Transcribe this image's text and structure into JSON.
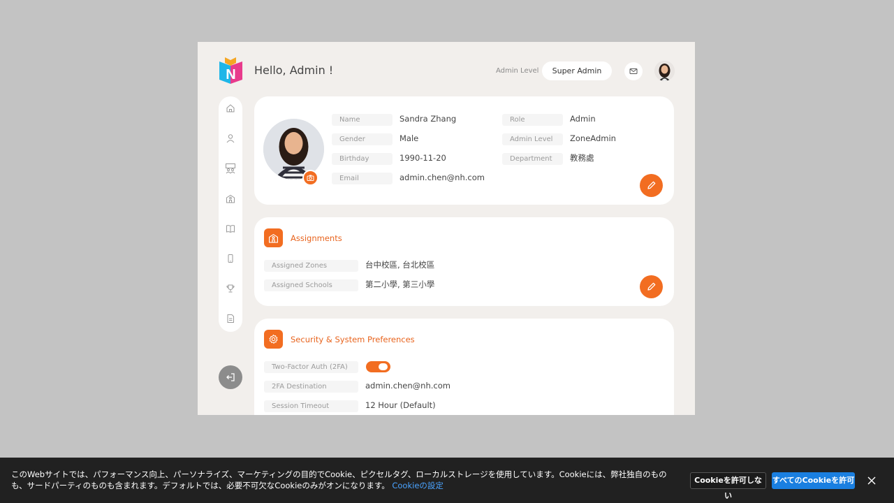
{
  "header": {
    "greeting": "Hello, Admin !",
    "admin_level_label": "Admin Level",
    "admin_level_value": "Super Admin",
    "mail_icon": "mail-icon",
    "avatar": "user-avatar"
  },
  "sidebar": {
    "items": [
      {
        "icon": "home-icon"
      },
      {
        "icon": "user-icon"
      },
      {
        "icon": "classroom-icon"
      },
      {
        "icon": "school-icon"
      },
      {
        "icon": "book-icon"
      },
      {
        "icon": "mobile-icon"
      },
      {
        "icon": "trophy-icon"
      },
      {
        "icon": "document-icon"
      }
    ],
    "logout_icon": "logout-icon"
  },
  "profile": {
    "fields": {
      "name_label": "Name",
      "name_value": "Sandra Zhang",
      "gender_label": "Gender",
      "gender_value": "Male",
      "birthday_label": "Birthday",
      "birthday_value": "1990-11-20",
      "email_label": "Email",
      "email_value": "admin.chen@nh.com",
      "role_label": "Role",
      "role_value": "Admin",
      "admin_level_label": "Admin Level",
      "admin_level_value": "ZoneAdmin",
      "department_label": "Department",
      "department_value": "教務處"
    }
  },
  "assignments": {
    "title": "Assignments",
    "zones_label": "Assigned Zones",
    "zones_value": "台中校區, 台北校區",
    "schools_label": "Assigned Schools",
    "schools_value": "第二小學, 第三小學"
  },
  "security": {
    "title": "Security & System Preferences",
    "twofa_label": "Two-Factor Auth (2FA)",
    "twofa_enabled": true,
    "destination_label": "2FA Destination",
    "destination_value": "admin.chen@nh.com",
    "timeout_label": "Session Timeout",
    "timeout_value": "12 Hour (Default)"
  },
  "cookie_banner": {
    "text": "このWebサイトでは、パフォーマンス向上、パーソナライズ、マーケティングの目的でCookie、ピクセルタグ、ローカルストレージを使用しています。Cookieには、弊社独自のものも、サードパーティのものも含まれます。デフォルトでは、必要不可欠なCookieのみがオンになります。",
    "settings_link": "Cookieの設定",
    "reject_label": "Cookieを許可しない",
    "accept_label": "すべてのCookieを許可"
  },
  "colors": {
    "accent": "#f26d21",
    "background": "#f2efec",
    "page": "#c3c3c3"
  }
}
